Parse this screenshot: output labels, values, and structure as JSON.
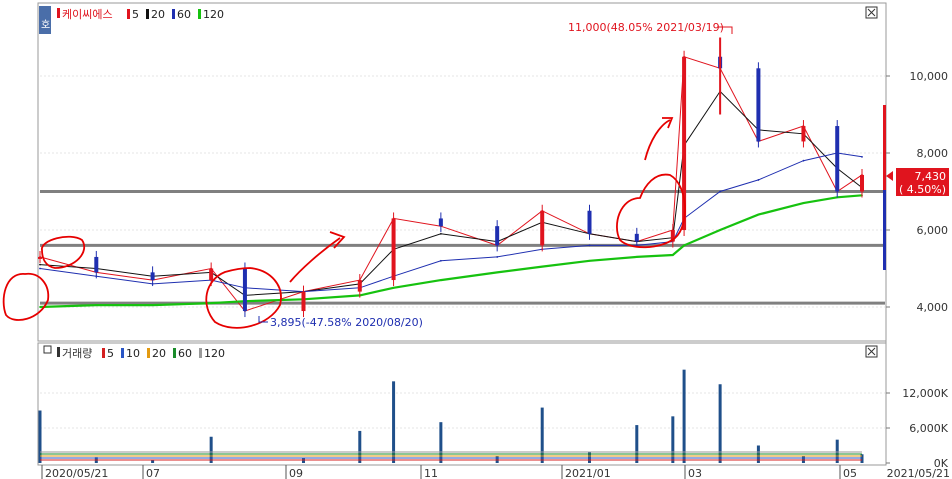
{
  "price_panel": {
    "title": "케이씨에스",
    "ma_legend": [
      {
        "label": "5",
        "color": "#e0141e"
      },
      {
        "label": "20",
        "color": "#111111"
      },
      {
        "label": "60",
        "color": "#1f2fb0"
      },
      {
        "label": "120",
        "color": "#16c20f"
      }
    ],
    "ticks": [
      "4,000",
      "6,000",
      "8,000",
      "10,000"
    ],
    "high_annotation": "11,000(48.05% 2021/03/19)",
    "low_annotation": "3,895(-47.58% 2020/08/20)",
    "current_price": "7,430",
    "current_change": "( 4.50%)"
  },
  "volume_panel": {
    "title": "거래량",
    "ma_legend": [
      {
        "label": "5",
        "color": "#d42020"
      },
      {
        "label": "10",
        "color": "#2a56c6"
      },
      {
        "label": "20",
        "color": "#e39a10"
      },
      {
        "label": "60",
        "color": "#1a8c2a"
      },
      {
        "label": "120",
        "color": "#9a9a9a"
      }
    ],
    "ticks": [
      "0K",
      "6,000K",
      "12,000K"
    ]
  },
  "x_axis": {
    "labels": [
      "2020/05/21",
      "07",
      "09",
      "11",
      "2021/01",
      "03",
      "05"
    ],
    "end_label": "2021/05/21"
  },
  "colors": {
    "up": "#e0141e",
    "down": "#1f2fb0",
    "support_line": "#808080",
    "annotation": "#e0141e",
    "low_annotation": "#1f2fb0",
    "price_box": "#e0141e",
    "hand_drawn": "#e60000"
  },
  "chart_data": [
    {
      "type": "line",
      "title": "케이씨에스",
      "ylim": [
        3400,
        11400
      ],
      "x": [
        "2020/05/21",
        "2020/06/15",
        "2020/07/10",
        "2020/08/05",
        "2020/08/20",
        "2020/09/15",
        "2020/10/10",
        "2020/10/25",
        "2020/11/15",
        "2020/12/10",
        "2020/12/30",
        "2021/01/20",
        "2021/02/10",
        "2021/02/26",
        "2021/03/03",
        "2021/03/19",
        "2021/04/05",
        "2021/04/25",
        "2021/05/10",
        "2021/05/21"
      ],
      "series": [
        {
          "name": "5",
          "values": [
            5300,
            4900,
            4700,
            5000,
            3895,
            4400,
            4700,
            6300,
            6100,
            5600,
            6500,
            5900,
            5700,
            6000,
            10500,
            10200,
            8300,
            8700,
            7000,
            7430
          ]
        },
        {
          "name": "20",
          "values": [
            5100,
            5000,
            4800,
            4900,
            4300,
            4400,
            4600,
            5500,
            5900,
            5700,
            6200,
            5900,
            5700,
            5800,
            8200,
            9600,
            8600,
            8500,
            7600,
            7100
          ]
        },
        {
          "name": "60",
          "values": [
            5000,
            4800,
            4600,
            4700,
            4500,
            4400,
            4500,
            4800,
            5200,
            5300,
            5500,
            5600,
            5600,
            5700,
            6300,
            7000,
            7300,
            7800,
            8000,
            7900
          ]
        },
        {
          "name": "120",
          "values": [
            4000,
            4050,
            4050,
            4100,
            4150,
            4200,
            4300,
            4500,
            4700,
            4900,
            5050,
            5200,
            5300,
            5350,
            5600,
            6000,
            6400,
            6700,
            6850,
            6900
          ]
        }
      ],
      "reference_levels": [
        4100,
        5600,
        7000
      ],
      "high": {
        "value": 11000,
        "date": "2021/03/19",
        "change_pct": 48.05
      },
      "low": {
        "value": 3895,
        "date": "2020/08/20",
        "change_pct": -47.58
      },
      "current": {
        "value": 7430,
        "change_pct": 4.5
      }
    },
    {
      "type": "bar",
      "title": "거래량",
      "ylim": [
        0,
        16000
      ],
      "categories": [
        "2020/05/21",
        "2020/06/15",
        "2020/07/10",
        "2020/08/05",
        "2020/09/15",
        "2020/10/10",
        "2020/10/25",
        "2020/11/15",
        "2020/12/10",
        "2020/12/30",
        "2021/01/20",
        "2021/02/10",
        "2021/02/26",
        "2021/03/03",
        "2021/03/19",
        "2021/04/05",
        "2021/04/25",
        "2021/05/10",
        "2021/05/21"
      ],
      "values": [
        9000,
        1000,
        600,
        4500,
        800,
        5500,
        14000,
        7000,
        1200,
        9500,
        1800,
        6500,
        8000,
        16000,
        13500,
        3000,
        1200,
        4000,
        1500
      ]
    }
  ]
}
